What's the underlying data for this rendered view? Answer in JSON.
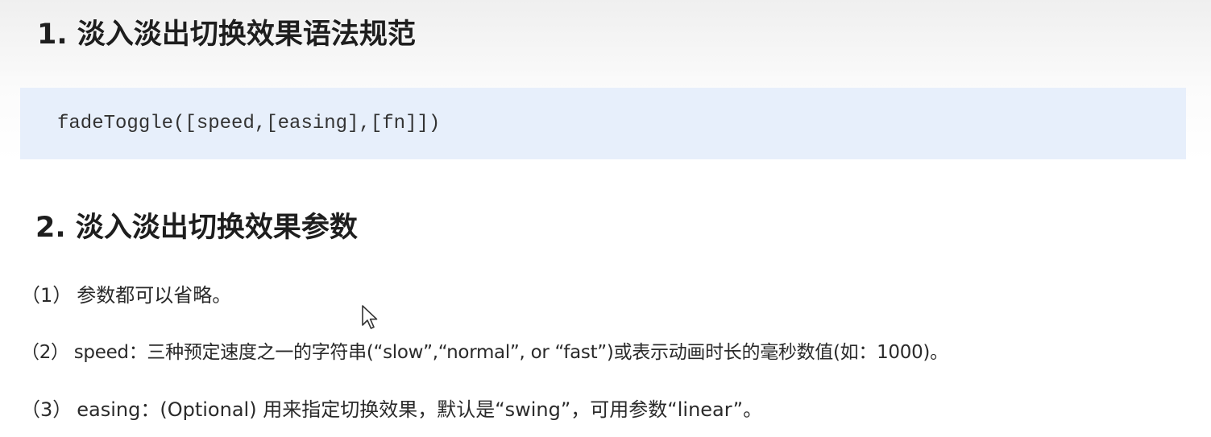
{
  "section1": {
    "title": "1. 淡入淡出切换效果语法规范",
    "code": "fadeToggle([speed,[easing],[fn]])"
  },
  "section2": {
    "title": "2. 淡入淡出切换效果参数",
    "params": [
      {
        "num": "（1）",
        "text": "参数都可以省略。"
      },
      {
        "num": "（2）",
        "text": "speed：三种预定速度之一的字符串(“slow”,“normal”, or “fast”)或表示动画时长的毫秒数值(如：1000)。"
      },
      {
        "num": "（3）",
        "text": "easing：(Optional) 用来指定切换效果，默认是“swing”，可用参数“linear”。"
      }
    ]
  },
  "cursor_icon": "mouse-pointer-icon"
}
